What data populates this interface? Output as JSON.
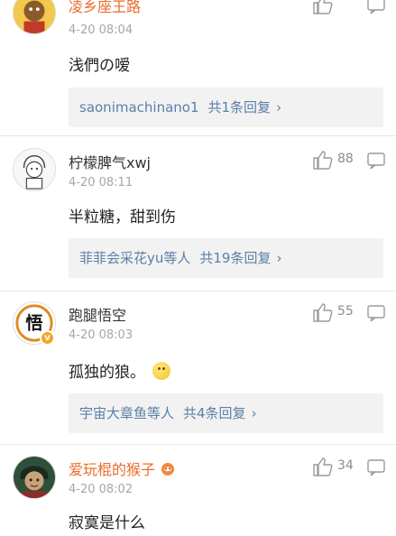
{
  "comments": [
    {
      "username": "凌乡座王路",
      "time": "4-20 08:04",
      "text": "浅們の嗳",
      "likes": "",
      "replies": {
        "who": "saonimachinano1",
        "count": "共1条回复",
        "arrow": "›"
      }
    },
    {
      "username": "柠檬脾气xwj",
      "time": "4-20 08:11",
      "text": "半粒糖，甜到伤",
      "likes": "88",
      "replies": {
        "who": "菲菲会采花yu等人",
        "count": "共19条回复",
        "arrow": "›"
      }
    },
    {
      "username": "跑腿悟空",
      "time": "4-20 08:03",
      "text": "孤独的狼。",
      "likes": "55",
      "avatar_text": "悟",
      "verified": "v",
      "replies": {
        "who": "宇宙大章鱼等人",
        "count": "共4条回复",
        "arrow": "›"
      }
    },
    {
      "username": "爱玩棍的猴子",
      "time": "4-20 08:02",
      "text": "寂寞是什么",
      "likes": "34"
    }
  ],
  "colors": {
    "link": "#5b7fa9",
    "vip_name": "#e86c2a",
    "reply_bg": "#f2f2f2",
    "meta": "#a6a6a6"
  }
}
